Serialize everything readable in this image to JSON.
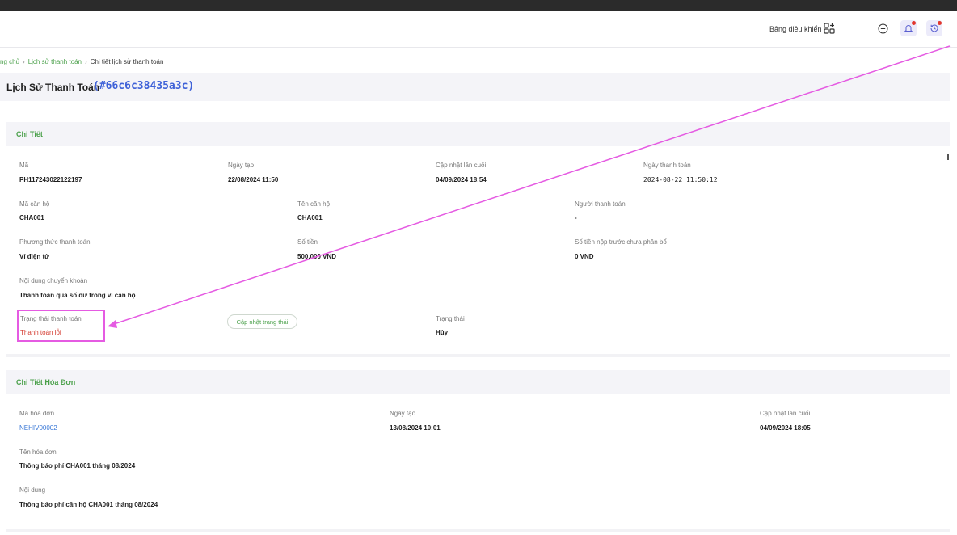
{
  "header": {
    "dashboard_label": "Bảng điều khiển",
    "icons": [
      "dashboard-grid-icon",
      "plus-circle-icon",
      "bell-icon",
      "history-icon"
    ]
  },
  "breadcrumb": {
    "home": "ng chủ",
    "history": "Lịch sử thanh toán",
    "current": "Chi tiết lịch sử thanh toán",
    "separator": "›"
  },
  "page": {
    "title": "Lịch Sử Thanh Toán",
    "id": "(#66c6c38435a3c)"
  },
  "details": {
    "heading": "Chi Tiết",
    "code_label": "Mã",
    "code_value": "PH117243022122197",
    "created_label": "Ngày tạo",
    "created_value": "22/08/2024 11:50",
    "updated_label": "Cập nhật lần cuối",
    "updated_value": "04/09/2024 18:54",
    "paid_date_label": "Ngày thanh toán",
    "paid_date_value": "2024-08-22 11:50:12",
    "apt_code_label": "Mã căn hộ",
    "apt_code_value": "CHA001",
    "apt_name_label": "Tên căn hộ",
    "apt_name_value": "CHA001",
    "payer_label": "Người thanh toán",
    "payer_value": "-",
    "method_label": "Phương thức thanh toán",
    "method_value": "Ví điện tử",
    "amount_label": "Số tiền",
    "amount_value": "500,000 VND",
    "prepaid_label": "Số tiền nộp trước chưa phân bổ",
    "prepaid_value": "0 VND",
    "transfer_label": "Nội dung chuyển khoản",
    "transfer_value": "Thanh toán qua số dư trong ví căn hộ",
    "pay_status_label": "Trạng thái thanh toán",
    "pay_status_value": "Thanh toán lỗi",
    "update_status_button": "Cập nhật trạng thái",
    "status_label": "Trạng thái",
    "status_value": "Hủy"
  },
  "invoice": {
    "heading": "Chi Tiết Hóa Đơn",
    "code_label": "Mã hóa đơn",
    "code_value": "NEHIV00002",
    "created_label": "Ngày tạo",
    "created_value": "13/08/2024 10:01",
    "updated_label": "Cập nhật lần cuối",
    "updated_value": "04/09/2024 18:05",
    "name_label": "Tên hóa đơn",
    "name_value": "Thông báo phí CHA001 tháng 08/2024",
    "content_label": "Nội dung",
    "content_value": "Thông báo phí căn hộ CHA001 tháng 08/2024"
  },
  "colors": {
    "accent_green": "#4aa04a",
    "id_blue": "#3f62d8",
    "error_red": "#d43a2f",
    "annotation_magenta": "#e55be2"
  }
}
